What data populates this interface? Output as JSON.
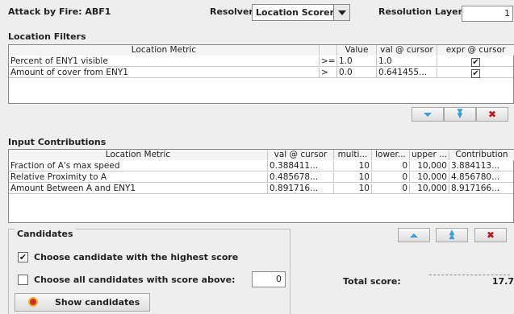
{
  "header": {
    "title": "Attack by Fire: ABF1",
    "resolver_label": "Resolver",
    "resolver_value": "Location Scorer",
    "layer_label": "Resolution Layer",
    "layer_value": "1"
  },
  "location_filters": {
    "title": "Location Filters",
    "columns": [
      "Location Metric",
      "",
      "Value",
      "val @ cursor",
      "expr @ cursor"
    ],
    "rows": [
      {
        "metric": "Percent of ENY1 visible",
        "op": ">=",
        "value": "1.0",
        "val_cursor": "1.0",
        "expr_cursor_mark": "✔"
      },
      {
        "metric": "Amount of cover from ENY1",
        "op": ">",
        "value": "0.0",
        "val_cursor": "0.641455...",
        "expr_cursor_mark": "✔"
      }
    ]
  },
  "input_contributions": {
    "title": "Input Contributions",
    "columns": [
      "Location Metric",
      "val @ cursor",
      "multi...",
      "lower...",
      "upper ...",
      "Contribution"
    ],
    "rows": [
      {
        "metric": "Fraction of A's max speed",
        "val_cursor": "0.388411...",
        "multi": "10",
        "lower": "0",
        "upper": "10,000",
        "contribution": "3.884113..."
      },
      {
        "metric": "Relative Proximity to A",
        "val_cursor": "0.485678...",
        "multi": "10",
        "lower": "0",
        "upper": "10,000",
        "contribution": "4.856780..."
      },
      {
        "metric": "Amount Between A and ENY1",
        "val_cursor": "0.891716...",
        "multi": "10",
        "lower": "0",
        "upper": "10,000",
        "contribution": "8.917166..."
      }
    ]
  },
  "candidates": {
    "title": "Candidates",
    "highest_label": "Choose candidate with the highest score",
    "highest_checked_mark": "✔",
    "above_label": "Choose all candidates with score above:",
    "above_value": "0",
    "show_label": "Show candidates"
  },
  "totals": {
    "label": "Total score:",
    "value": "17.7"
  },
  "colors": {
    "accent_blue": "#3f9bd6",
    "delete_red": "#c0141c"
  }
}
